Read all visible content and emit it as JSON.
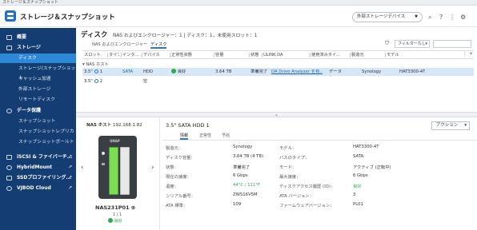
{
  "window": {
    "title": "ストレージ＆スナップショット"
  },
  "header": {
    "app_title": "ストレージ＆スナップショット",
    "external_device_dropdown": "外部ストレージデバイス",
    "icons": [
      "search-icon",
      "help-icon",
      "more-icon",
      "gear-icon"
    ]
  },
  "sidebar": {
    "overview": "概要",
    "storage_section": "ストレージ",
    "storage_items": [
      "ディスク",
      "ストレージ/スナップショット",
      "キャッシュ加速",
      "外部ストレージ",
      "リモートディスク"
    ],
    "data_protection_section": "データ保護",
    "data_protection_items": [
      "スナップショット",
      "スナップショットレプリカ",
      "スナップショットボールト"
    ],
    "bottom_items": [
      "iSCSI & ファイバーチ...",
      "HybridMount",
      "SSDプロファイリング...",
      "VJBOD Cloud"
    ]
  },
  "main": {
    "title": "ディスク",
    "breadcrumb": "NAS およびエンクロージャー：1 | ディスク：1，未使用スロット：1",
    "tabs": [
      "NAS およびエンクロージャー",
      "ディスク"
    ],
    "filter_label": "フィルターなし",
    "columns": [
      "スロット",
      "タイプ",
      "インタ...",
      "デバイス",
      "正常性状態",
      "容量",
      "状態",
      "ULINK DA",
      "使用済みタイ...",
      "製造元",
      "モデル"
    ],
    "group_label": "NAS ホスト",
    "rows": [
      {
        "slot": "3.5\"",
        "slot_num": "1",
        "interface": "SATA",
        "device": "HDD",
        "health": "良好",
        "capacity": "3.64 TB",
        "status": "準備完了",
        "ulink": "DA Drive Analyzer を有...",
        "used_type": "データ",
        "manufacturer": "Synology",
        "model": "HAT3300-4T"
      },
      {
        "slot": "3.5\"",
        "slot_num": "2",
        "interface": "",
        "device": "空",
        "health": "",
        "capacity": "",
        "status": "",
        "ulink": "",
        "used_type": "",
        "manufacturer": "",
        "model": ""
      }
    ]
  },
  "detail": {
    "nas_host_label": "NAS ホスト",
    "nas_ip": "192.168.1.82",
    "nas_brand": "QNAP",
    "nas_name": "NAS231P01",
    "nas_count": "1 / 1",
    "nas_status": "良好",
    "disk_title": "3.5\" SATA HDD 1",
    "action_label": "アクション",
    "subtabs": [
      "情報",
      "正常性",
      "予兆"
    ],
    "props_left": [
      {
        "label": "製造元：",
        "value": "Synology"
      },
      {
        "label": "ディスク容量：",
        "value": "3.64 TB (4 TB)"
      },
      {
        "label": "状態：",
        "value": "準備完了"
      },
      {
        "label": "現在の速度：",
        "value": "6 Gbps"
      },
      {
        "label": "温度：",
        "value": "44°C / 111°F"
      },
      {
        "label": "シリアル番号：",
        "value": "ZWS16V5M"
      },
      {
        "label": "ATA 標準：",
        "value": "109"
      }
    ],
    "props_right": [
      {
        "label": "モデル：",
        "value": "HAT3300-4T"
      },
      {
        "label": "バスのタイプ：",
        "value": "SATA"
      },
      {
        "label": "モード：",
        "value": "アクティブ (正転中)"
      },
      {
        "label": "最大速度：",
        "value": "6 Gbps"
      },
      {
        "label": "ディスクアクセス履歴 (IO)：",
        "value": "良好"
      },
      {
        "label": "ATA バージョン：",
        "value": "3"
      },
      {
        "label": "ファームウェアバージョン：",
        "value": "PL01"
      }
    ]
  },
  "colors": {
    "sidebar_bg": "#143d74",
    "sidebar_active": "#2d88d7",
    "selected_row": "#d6e8f8",
    "ok_green": "#2da94f",
    "link": "#1a63b8"
  }
}
